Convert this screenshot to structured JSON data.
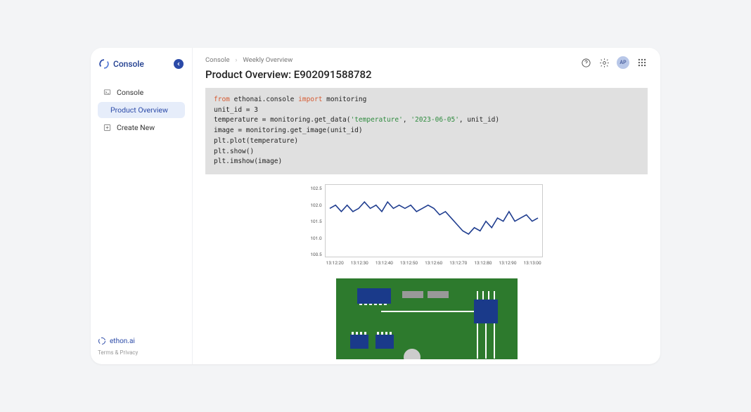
{
  "sidebar": {
    "logo_text": "Console",
    "items": [
      {
        "label": "Console"
      },
      {
        "label": "Product Overview"
      },
      {
        "label": "Create New"
      }
    ],
    "footer_brand": "ethon.ai",
    "footer_link": "Terms & Privacy"
  },
  "header": {
    "breadcrumb": [
      "Console",
      "Weekly Overview"
    ],
    "page_title": "Product Overview: E902091588782",
    "avatar_initials": "AP"
  },
  "code": {
    "line1_from": "from",
    "line1_mod": " ethonai.console ",
    "line1_import": "import",
    "line1_rest": " monitoring",
    "line2": "unit_id = 3",
    "line3a": "temperature = monitoring.get_data(",
    "line3s1": "'temperature'",
    "line3b": ", ",
    "line3s2": "'2023-06-05'",
    "line3c": ", unit_id)",
    "line4": "image = monitoring.get_image(unit_id)",
    "line5": "plt.plot(temperature)",
    "line6": "plt.show()",
    "line7": "plt.imshow(image)"
  },
  "chart_data": {
    "type": "line",
    "ylabel": "",
    "xlabel": "",
    "ylim": [
      100.5,
      102.5
    ],
    "y_ticks": [
      "102.5",
      "102.0",
      "101.5",
      "101.0",
      "100.5"
    ],
    "x_ticks": [
      "13:12:20",
      "13:12:30",
      "13:12:40",
      "13:12:50",
      "13:12:60",
      "13:12:70",
      "13:12:80",
      "13:12:90",
      "13:13:00"
    ],
    "series": [
      {
        "name": "temperature",
        "values": [
          101.9,
          102.0,
          101.8,
          102.0,
          101.8,
          101.9,
          102.1,
          101.9,
          102.0,
          101.8,
          102.1,
          101.9,
          102.0,
          101.9,
          102.0,
          101.8,
          101.9,
          102.0,
          101.9,
          101.7,
          101.8,
          101.6,
          101.4,
          101.2,
          101.1,
          101.3,
          101.2,
          101.5,
          101.3,
          101.6,
          101.5,
          101.8,
          101.5,
          101.6,
          101.7,
          101.5,
          101.6
        ]
      }
    ]
  }
}
